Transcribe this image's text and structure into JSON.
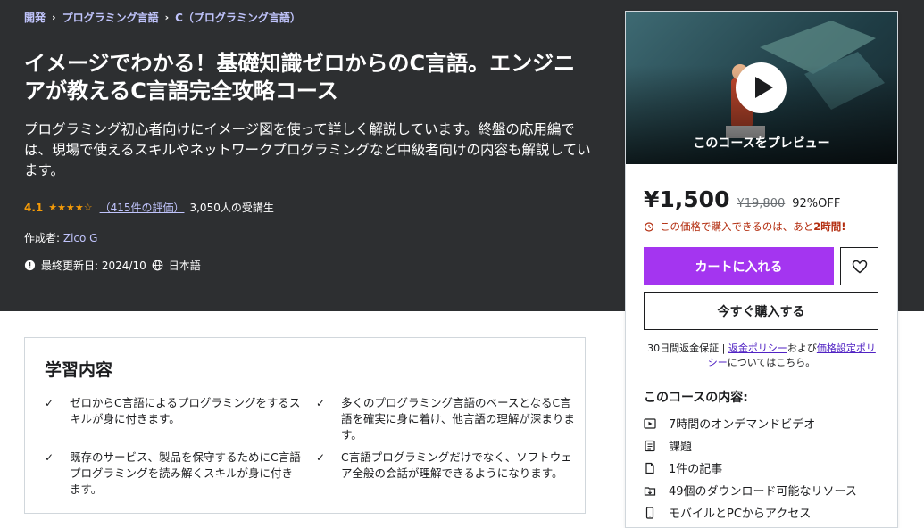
{
  "breadcrumb": [
    "開発",
    "プログラミング言語",
    "C（プログラミング言語）"
  ],
  "course": {
    "title": "イメージでわかる！基礎知識ゼロからのC言語。エンジニアが教えるC言語完全攻略コース",
    "subtitle": "プログラミング初心者向けにイメージ図を使って詳しく解説しています。終盤の応用編では、現場で使えるスキルやネットワークプログラミングなど中級者向けの内容も解説しています。",
    "rating": "4.1",
    "rating_value": 4.1,
    "rating_count": "（415件の評価）",
    "students": "3,050人の受講生",
    "author_label": "作成者:",
    "author": "Zico G",
    "updated": "最終更新日: 2024/10",
    "language": "日本語"
  },
  "sidebar": {
    "preview_label": "このコースをプレビュー",
    "price": "¥1,500",
    "old_price": "¥19,800",
    "discount": "92%OFF",
    "timer_text": "この価格で購入できるのは、あと",
    "timer_bold": "2時間!",
    "cart_label": "カートに入れる",
    "buy_label": "今すぐ購入する",
    "guarantee_text": "30日間返金保証 | ",
    "refund_link": "返金ポリシー",
    "and_text": "および",
    "pricing_link": "価格設定ポリシー",
    "about_text": "についてはこちら。",
    "includes_title": "このコースの内容:",
    "includes": [
      {
        "icon": "video-icon",
        "text": "7時間のオンデマンドビデオ"
      },
      {
        "icon": "assignment-icon",
        "text": "課題"
      },
      {
        "icon": "article-icon",
        "text": "1件の記事"
      },
      {
        "icon": "download-icon",
        "text": "49個のダウンロード可能なリソース"
      },
      {
        "icon": "mobile-icon",
        "text": "モバイルとPCからアクセス"
      }
    ]
  },
  "learn": {
    "title": "学習内容",
    "items": [
      "ゼロからC言語によるプログラミングをするスキルが身に付きます。",
      "多くのプログラミング言語のベースとなるC言語を確実に身に着け、他言語の理解が深まります。",
      "既存のサービス、製品を保守するためにC言語プログラミングを読み解くスキルが身に付きます。",
      "C言語プログラミングだけでなく、ソフトウェア全般の会話が理解できるようになります。"
    ]
  },
  "colors": {
    "hero_bg": "#2d2f31",
    "accent_purple": "#a435f0",
    "link_lavender": "#c0c4fc",
    "star_orange": "#f69c08",
    "timer_red": "#b32d0f"
  }
}
